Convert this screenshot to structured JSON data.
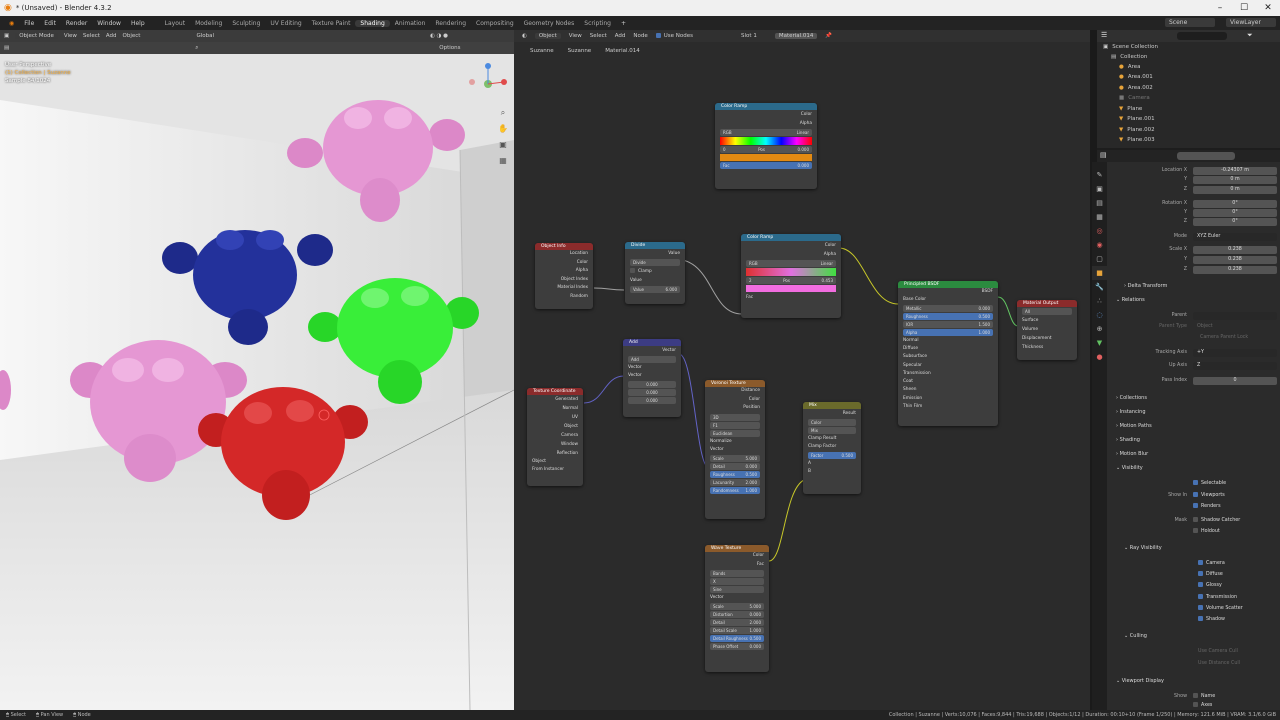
{
  "window": {
    "title": "* (Unsaved) - Blender 4.3.2"
  },
  "menus": [
    "File",
    "Edit",
    "Render",
    "Window",
    "Help"
  ],
  "workspaces": [
    "Layout",
    "Modeling",
    "Sculpting",
    "UV Editing",
    "Texture Paint",
    "Shading",
    "Animation",
    "Rendering",
    "Compositing",
    "Geometry Nodes",
    "Scripting"
  ],
  "active_workspace": "Shading",
  "scene_name": "Scene",
  "view_layer": "ViewLayer",
  "viewport": {
    "mode": "Object Mode",
    "menus": [
      "View",
      "Select",
      "Add",
      "Object"
    ],
    "transform": "Global",
    "info_line1": "User Perspective",
    "info_line2": "(1) Collection | Suzanne",
    "info_line3": "Sample 84/1024",
    "options_label": "Options"
  },
  "node_editor": {
    "type": "Object",
    "menus": [
      "View",
      "Select",
      "Add",
      "Node"
    ],
    "use_nodes": "Use Nodes",
    "slot": "Slot 1",
    "material": "Material.014",
    "breadcrumb": [
      "Suzanne",
      "Suzanne",
      "Material.014"
    ],
    "nodes": {
      "color_ramp1": {
        "title": "Color Ramp",
        "out1": "Color",
        "out2": "Alpha",
        "mode": "RGB",
        "interp": "Linear",
        "pos_label": "Pos",
        "pos": "0.000",
        "idx": "0",
        "fac": "Fac",
        "fac_val": "0.000"
      },
      "object_info": {
        "title": "Object Info",
        "outs": [
          "Location",
          "Color",
          "Alpha",
          "Object Index",
          "Material Index",
          "Random"
        ]
      },
      "divide": {
        "title": "Divide",
        "out": "Value",
        "op": "Divide",
        "clamp": "Clamp",
        "in1": "Value",
        "in2_label": "Value",
        "in2": "6.000"
      },
      "color_ramp2": {
        "title": "Color Ramp",
        "out1": "Color",
        "out2": "Alpha",
        "mode": "RGB",
        "interp": "Linear",
        "idx": "2",
        "pos_label": "Pos",
        "pos": "0.453",
        "fac": "Fac"
      },
      "principled": {
        "title": "Principled BSDF",
        "out": "BSDF",
        "base": "Base Color",
        "metallic": "Metallic",
        "metallic_v": "0.000",
        "rough": "Roughness",
        "rough_v": "0.500",
        "ior": "IOR",
        "ior_v": "1.500",
        "alpha": "Alpha",
        "alpha_v": "1.000",
        "normal": "Normal",
        "subs": [
          "Diffuse",
          "Subsurface",
          "Specular",
          "Transmission",
          "Coat",
          "Sheen",
          "Emission",
          "Thin Film"
        ]
      },
      "material_output": {
        "title": "Material Output",
        "target": "All",
        "ins": [
          "Surface",
          "Volume",
          "Displacement",
          "Thickness"
        ]
      },
      "add": {
        "title": "Add",
        "out": "Vector",
        "op": "Add",
        "in1": "Vector",
        "in2": "Vector",
        "v": [
          "0.000",
          "0.000",
          "0.000"
        ]
      },
      "texcoord": {
        "title": "Texture Coordinate",
        "outs": [
          "Generated",
          "Normal",
          "UV",
          "Object",
          "Camera",
          "Window",
          "Reflection"
        ],
        "obj": "Object",
        "inst": "From Instancer"
      },
      "voronoi": {
        "title": "Voronoi Texture",
        "outs": [
          "Distance",
          "Color",
          "Position"
        ],
        "dim": "3D",
        "feature": "F1",
        "metric": "Euclidean",
        "normalize": "Normalize",
        "vector": "Vector",
        "scale_l": "Scale",
        "scale": "5.000",
        "detail_l": "Detail",
        "detail": "0.000",
        "rough_l": "Roughness",
        "rough": "0.500",
        "lac_l": "Lacunarity",
        "lac": "2.000",
        "rand_l": "Randomness",
        "rand": "1.000"
      },
      "mix": {
        "title": "Mix",
        "out": "Result",
        "type": "Color",
        "blend": "Mix",
        "clamp_res": "Clamp Result",
        "clamp_fac": "Clamp Factor",
        "fac_l": "Factor",
        "fac": "0.500",
        "a": "A",
        "b": "B"
      },
      "wave": {
        "title": "Wave Texture",
        "outs": [
          "Color",
          "Fac"
        ],
        "type": "Bands",
        "dir": "X",
        "profile": "Sine",
        "vector": "Vector",
        "scale_l": "Scale",
        "scale": "5.000",
        "dist_l": "Distortion",
        "dist": "0.000",
        "detail_l": "Detail",
        "detail": "2.000",
        "dscale_l": "Detail Scale",
        "dscale": "1.000",
        "drough_l": "Detail Roughness",
        "drough": "0.500",
        "phase_l": "Phase Offset",
        "phase": "0.000"
      }
    }
  },
  "outliner": {
    "root": "Scene Collection",
    "collection": "Collection",
    "items": [
      "Area",
      "Area.001",
      "Area.002",
      "Camera",
      "Plane",
      "Plane.001",
      "Plane.002",
      "Plane.003"
    ]
  },
  "properties": {
    "location_x_label": "Location X",
    "location_x": "-0.24307 m",
    "y_label": "Y",
    "loc_y": "0 m",
    "z_label": "Z",
    "loc_z": "0 m",
    "rotation_x_label": "Rotation X",
    "rot_x": "0°",
    "rot_y": "0°",
    "rot_z": "0°",
    "mode_label": "Mode",
    "mode": "XYZ Euler",
    "scale_x_label": "Scale X",
    "scale_x": "0.238",
    "scale_y": "0.238",
    "scale_z": "0.238",
    "delta": "Delta Transform",
    "relations": "Relations",
    "parent_label": "Parent",
    "parent_type_label": "Parent Type",
    "parent_type": "Object",
    "camera_parent": "Camera Parent Lock",
    "tracking_label": "Tracking Axis",
    "tracking": "+Y",
    "up_label": "Up Axis",
    "up": "Z",
    "pass_label": "Pass Index",
    "pass": "0",
    "sections": [
      "Collections",
      "Instancing",
      "Motion Paths",
      "Shading",
      "Motion Blur",
      "Visibility"
    ],
    "selectable": "Selectable",
    "show_in": "Show In",
    "viewports": "Viewports",
    "renders": "Renders",
    "mask": "Mask",
    "shadow_catcher": "Shadow Catcher",
    "holdout": "Holdout",
    "ray_vis": "Ray Visibility",
    "camera": "Camera",
    "diffuse": "Diffuse",
    "glossy": "Glossy",
    "transmission": "Transmission",
    "volume_scatter": "Volume Scatter",
    "shadow": "Shadow",
    "culling": "Culling",
    "use_camera_cull": "Use Camera Cull",
    "use_distance_cull": "Use Distance Cull",
    "viewport_display": "Viewport Display",
    "show": "Show",
    "name": "Name",
    "axes": "Axes"
  },
  "status": {
    "left": [
      "Select",
      "Pan View",
      "Node"
    ],
    "right": "Collection | Suzanne | Verts:10,076 | Faces:9,844 | Tris:19,688 | Objects:1/12 | Duration: 00:10+10 (Frame 1/250) | Memory: 121.6 MiB | VRAM: 3.1/6.0 GiB"
  }
}
